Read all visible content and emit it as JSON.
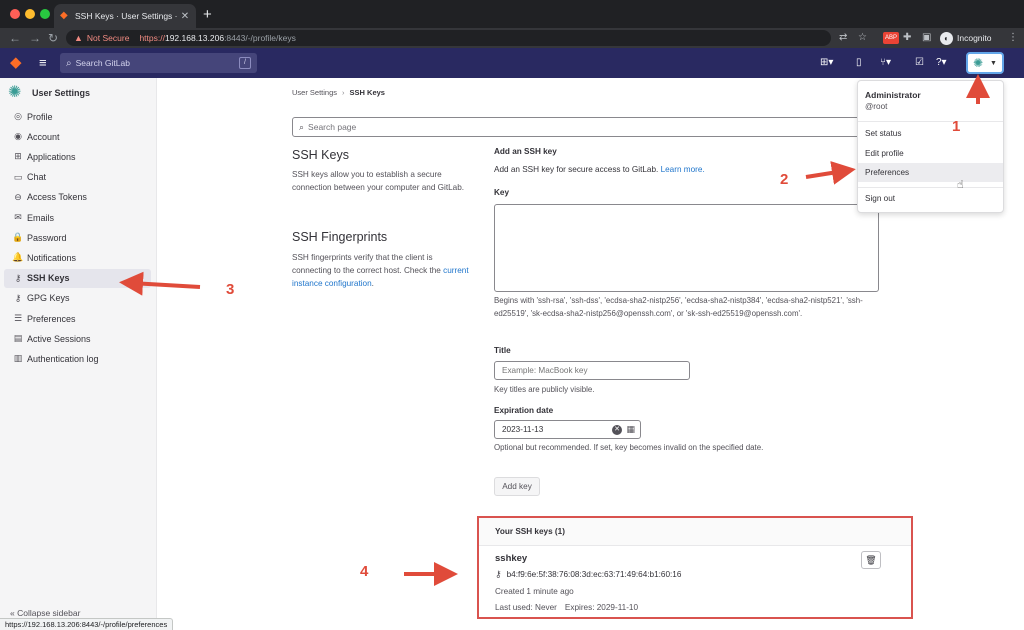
{
  "browser": {
    "tab_title": "SSH Keys · User Settings · Git",
    "tab_close": "✕",
    "new_tab": "+",
    "not_secure_label": "Not Secure",
    "url_scheme": "https://",
    "url_host": "192.168.13.206",
    "url_rest": ":8443/-/profile/keys",
    "incognito_label": "Incognito",
    "status_url": "https://192.168.13.206:8443/-/profile/preferences"
  },
  "topbar": {
    "search_placeholder": "Search GitLab",
    "search_shortcut": "/"
  },
  "sidebar": {
    "title": "User Settings",
    "items": [
      {
        "label": "Profile",
        "icon": "user-icon"
      },
      {
        "label": "Account",
        "icon": "account-icon"
      },
      {
        "label": "Applications",
        "icon": "applications-icon"
      },
      {
        "label": "Chat",
        "icon": "chat-icon"
      },
      {
        "label": "Access Tokens",
        "icon": "token-icon"
      },
      {
        "label": "Emails",
        "icon": "email-icon"
      },
      {
        "label": "Password",
        "icon": "lock-icon"
      },
      {
        "label": "Notifications",
        "icon": "bell-icon"
      },
      {
        "label": "SSH Keys",
        "icon": "key-icon",
        "active": true
      },
      {
        "label": "GPG Keys",
        "icon": "key-icon"
      },
      {
        "label": "Preferences",
        "icon": "preferences-icon"
      },
      {
        "label": "Active Sessions",
        "icon": "sessions-icon"
      },
      {
        "label": "Authentication log",
        "icon": "log-icon"
      }
    ],
    "collapse_label": "Collapse sidebar"
  },
  "breadcrumb": {
    "parent": "User Settings",
    "separator": "›",
    "current": "SSH Keys"
  },
  "search_page": {
    "placeholder": "Search page"
  },
  "ssh_keys_section": {
    "heading": "SSH Keys",
    "description": "SSH keys allow you to establish a secure connection between your computer and GitLab."
  },
  "fingerprints_section": {
    "heading": "SSH Fingerprints",
    "description": "SSH fingerprints verify that the client is connecting to the correct host. Check the",
    "link": "current instance configuration",
    "period": "."
  },
  "add_form": {
    "heading": "Add an SSH key",
    "intro": "Add an SSH key for secure access to GitLab.",
    "learn_more": "Learn more.",
    "key_label": "Key",
    "key_help": "Begins with 'ssh-rsa', 'ssh-dss', 'ecdsa-sha2-nistp256', 'ecdsa-sha2-nistp384', 'ecdsa-sha2-nistp521', 'ssh-ed25519', 'sk-ecdsa-sha2-nistp256@openssh.com', or 'sk-ssh-ed25519@openssh.com'.",
    "title_label": "Title",
    "title_placeholder": "Example: MacBook key",
    "title_help": "Key titles are publicly visible.",
    "expiration_label": "Expiration date",
    "expiration_value": "2023-11-13",
    "expiration_help": "Optional but recommended. If set, key becomes invalid on the specified date.",
    "submit_label": "Add key"
  },
  "keys_list": {
    "heading": "Your SSH keys (1)",
    "keys": [
      {
        "name": "sshkey",
        "fingerprint": "b4:f9:6e:5f:38:76:08:3d:ec:63:71:49:64:b1:60:16",
        "created": "Created 1 minute ago",
        "last_used": "Last used: Never",
        "expires": "Expires: 2029-11-10"
      }
    ]
  },
  "user_menu": {
    "name": "Administrator",
    "username": "@root",
    "items": [
      "Set status",
      "Edit profile",
      "Preferences",
      "Sign out"
    ]
  },
  "annotations": [
    "1",
    "2",
    "3",
    "4"
  ],
  "colors": {
    "topbar_bg": "#292961",
    "link": "#1f75cb",
    "annotation_red": "#e04b3a",
    "highlight_border": "#d9534f"
  }
}
